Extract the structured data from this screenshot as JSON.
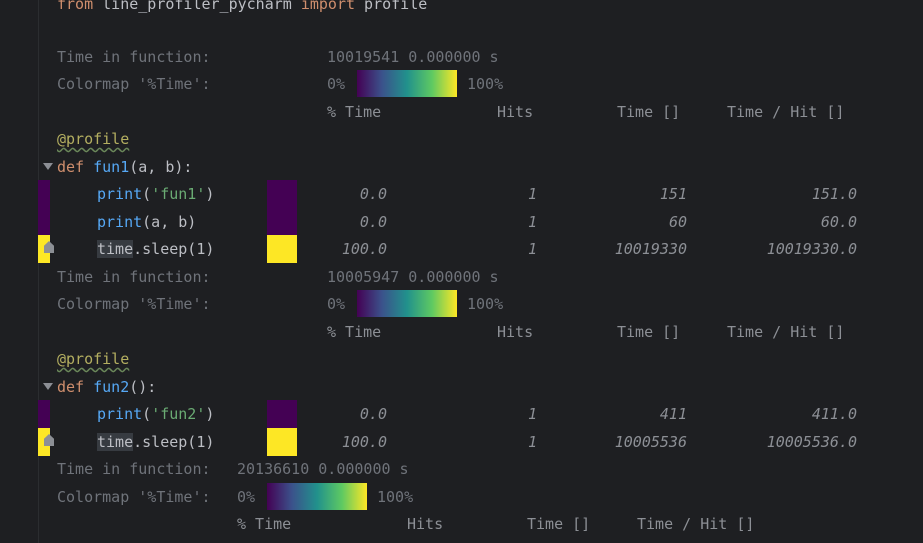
{
  "editor": {
    "import_line": {
      "kw_from": "from",
      "module": " line_profiler_pycharm ",
      "kw_import": "import",
      "name": " profile"
    },
    "block1": {
      "time_label": "Time in function:",
      "time_value": "10019541 0.000000 s",
      "colormap_label": "Colormap '%Time':",
      "pct0": "0%",
      "pct100": "100%",
      "headers": [
        "% Time",
        "Hits",
        "Time []",
        "Time / Hit []"
      ]
    },
    "decorator1": "@profile",
    "def1": {
      "kw": "def",
      "name": "fun1",
      "args": "(a, b):"
    },
    "fun1_rows": [
      {
        "code_fn": "print",
        "code_open": "(",
        "code_str": "'fun1'",
        "code_close": ")",
        "pct": "0.0",
        "hits": "1",
        "time": "151",
        "per_hit": "151.0"
      },
      {
        "code_fn": "print",
        "code_rest": "(a, b)",
        "pct": "0.0",
        "hits": "1",
        "time": "60",
        "per_hit": "60.0"
      },
      {
        "code_sel": "time",
        "code_rest": ".sleep(1)",
        "pct": "100.0",
        "hits": "1",
        "time": "10019330",
        "per_hit": "10019330.0"
      }
    ],
    "block2": {
      "time_label": "Time in function:",
      "time_value": "10005947 0.000000 s",
      "colormap_label": "Colormap '%Time':",
      "pct0": "0%",
      "pct100": "100%",
      "headers": [
        "% Time",
        "Hits",
        "Time []",
        "Time / Hit []"
      ]
    },
    "decorator2": "@profile",
    "def2": {
      "kw": "def",
      "name": "fun2",
      "args": "():"
    },
    "fun2_rows": [
      {
        "code_fn": "print",
        "code_open": "(",
        "code_str": "'fun2'",
        "code_close": ")",
        "pct": "0.0",
        "hits": "1",
        "time": "411",
        "per_hit": "411.0"
      },
      {
        "code_sel": "time",
        "code_rest": ".sleep(1)",
        "pct": "100.0",
        "hits": "1",
        "time": "10005536",
        "per_hit": "10005536.0"
      }
    ],
    "block3": {
      "time_label": "Time in function:",
      "time_value": "20136610 0.000000 s",
      "colormap_label": "Colormap '%Time':",
      "pct0": "0%",
      "pct100": "100%",
      "headers": [
        "% Time",
        "Hits",
        "Time []",
        "Time / Hit []"
      ]
    }
  },
  "colors": {
    "background": "#1e1f22",
    "viridis_low": "#440154",
    "viridis_high": "#fde725"
  }
}
